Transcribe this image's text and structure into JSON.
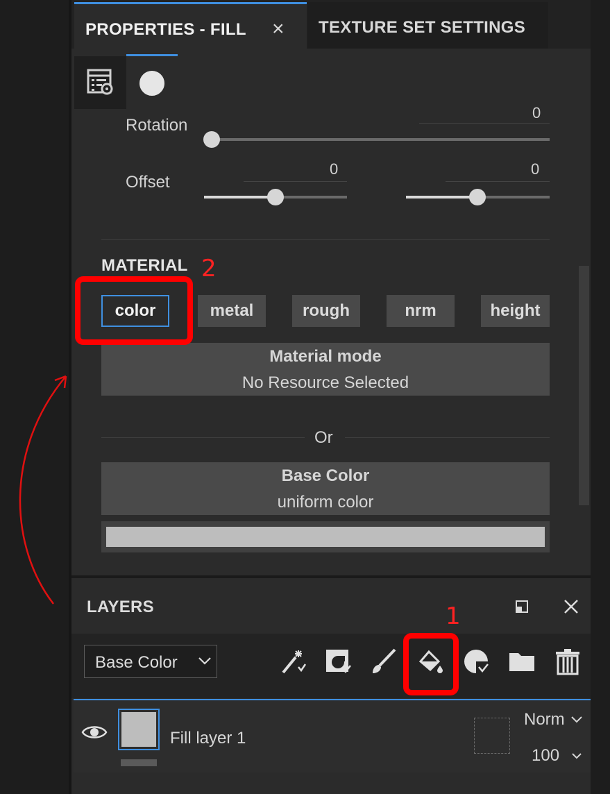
{
  "properties_panel": {
    "active_tab_label": "PROPERTIES - FILL",
    "close_glyph": "×",
    "other_tab_label": "TEXTURE SET SETTINGS",
    "subtabs": [
      "layer-settings-icon",
      "material-ball-icon"
    ]
  },
  "uv": {
    "rotation_label": "Rotation",
    "rotation_value": "0",
    "rotation_level": 0,
    "offset_label": "Offset",
    "offset_u_value": "0",
    "offset_v_value": "0",
    "offset_u_level": 0.5,
    "offset_v_level": 0.5
  },
  "material": {
    "section_title": "MATERIAL",
    "channels": [
      {
        "label": "color",
        "selected": true
      },
      {
        "label": "metal",
        "selected": false
      },
      {
        "label": "rough",
        "selected": false
      },
      {
        "label": "nrm",
        "selected": false
      },
      {
        "label": "height",
        "selected": false
      }
    ],
    "mode_title": "Material mode",
    "mode_value": "No Resource Selected",
    "or_label": "Or",
    "base_color_title": "Base Color",
    "base_color_value": "uniform color",
    "swatch_color": "#bdbdbd"
  },
  "layers_panel": {
    "title": "LAYERS",
    "channel_dropdown": "Base Color",
    "tools": [
      "effects-wand-icon",
      "add-generator-icon",
      "paint-brush-icon",
      "fill-bucket-icon",
      "mask-icon",
      "folder-icon",
      "trash-icon"
    ],
    "layer": {
      "name": "Fill layer 1",
      "blend_mode": "Norm",
      "opacity": "100"
    }
  },
  "annotations": {
    "number_1": "1",
    "number_2": "2"
  },
  "colors": {
    "accent": "#3f8fe0",
    "annotation": "#ff0000"
  }
}
